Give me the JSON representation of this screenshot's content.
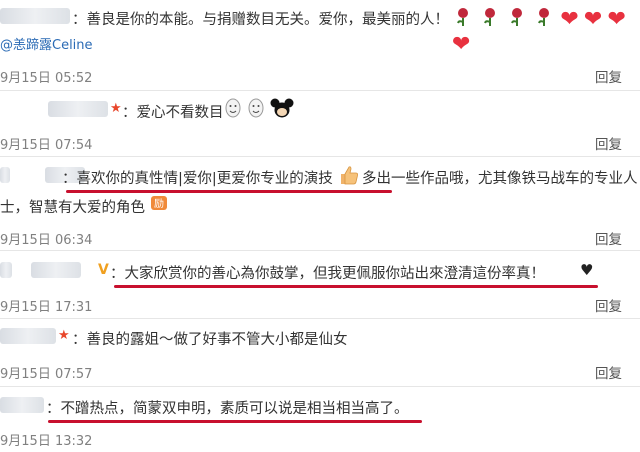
{
  "comments": [
    {
      "text": "：善良是你的本能。与捐赠数目无关。爱你，最美丽的人！",
      "hearts": [
        "❤",
        "❤",
        "❤",
        "❤"
      ],
      "sub_user": "@恙蹄露Celine",
      "date": "9月15日 05:52",
      "reply": "回复"
    },
    {
      "text": "：爱心不看数目",
      "date": "9月15日 07:54",
      "reply": "回复"
    },
    {
      "line1a": "：喜欢你的真性情|爱你|更爱你专业的演技",
      "line1b": "多出一些作品哦，尤其像铁马战车的专业人",
      "line2": "士，智慧有大爱的角色",
      "date": "9月15日 06:34",
      "reply": "回复"
    },
    {
      "badge": "V",
      "text": "：大家欣赏你的善心為你鼓掌，但我更佩服你站出來澄清這份率真！",
      "heart": "♥",
      "date": "9月15日 17:31",
      "reply": "回复"
    },
    {
      "text": "：善良的露姐～做了好事不管大小都是仙女",
      "date": "9月15日 07:57",
      "reply": "回复"
    },
    {
      "text": "：不蹭热点，简蒙双申明，素质可以说是相当相当高了。",
      "date": "9月15日 13:32",
      "reply": "回复"
    }
  ],
  "colors": {
    "underline": "#c8102e",
    "rose": "#c0283b",
    "heart": "#e8313f",
    "link": "#2b6bb5"
  },
  "icons": [
    "rose-icon",
    "heart-icon",
    "star-badge-icon",
    "v-badge-icon",
    "thumbs-up-icon",
    "mickey-icon",
    "smile-icon",
    "rocket-icon"
  ]
}
